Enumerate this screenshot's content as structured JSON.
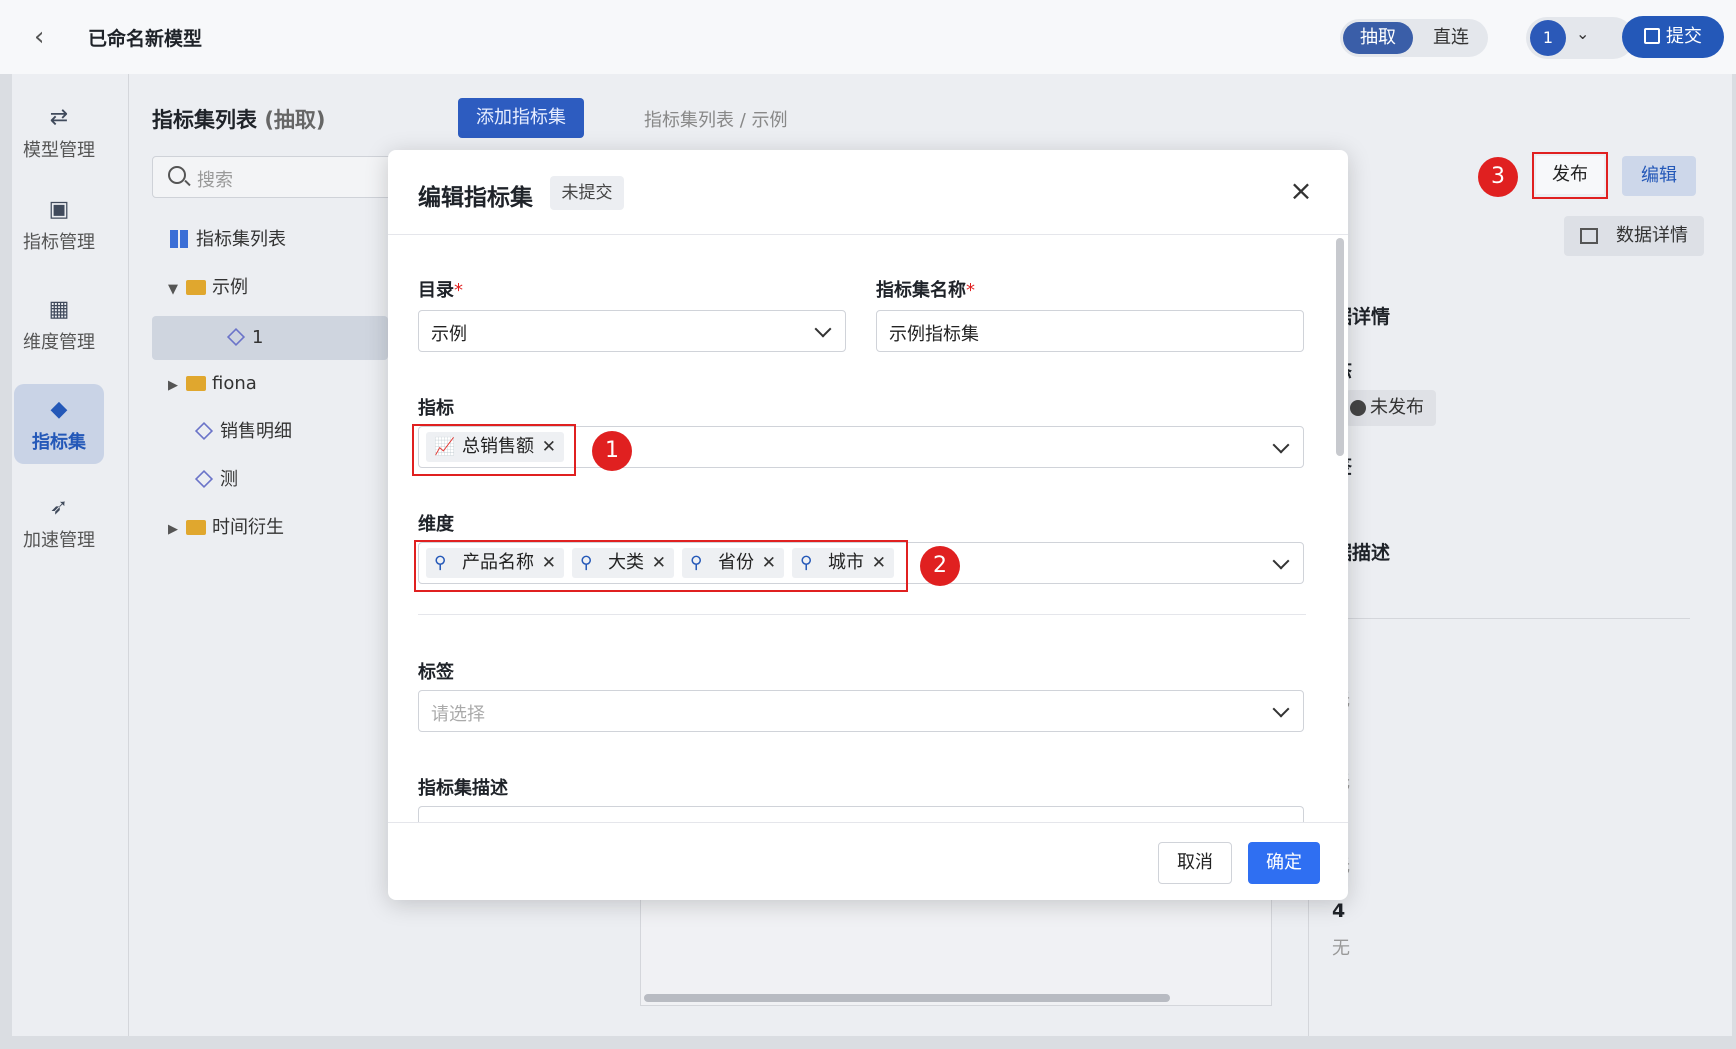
{
  "header": {
    "title": "已命名新模型",
    "mode_extract": "抽取",
    "mode_direct": "直连",
    "user_badge": "1",
    "submit_label": "提交"
  },
  "nav": [
    {
      "label": "模型管理",
      "icon": "model-icon"
    },
    {
      "label": "指标管理",
      "icon": "chart-icon"
    },
    {
      "label": "维度管理",
      "icon": "dimension-icon"
    },
    {
      "label": "指标集",
      "icon": "cube-icon"
    },
    {
      "label": "加速管理",
      "icon": "rocket-icon"
    }
  ],
  "list": {
    "title": "指标集列表",
    "title_suffix": "(抽取)",
    "add_label": "添加指标集",
    "search_placeholder": "搜索",
    "tree": [
      {
        "label": "指标集列表",
        "icon": "grid-icon"
      },
      {
        "label": "示例",
        "icon": "folder-icon"
      },
      {
        "label": "1",
        "icon": "cube-icon"
      },
      {
        "label": "fiona",
        "icon": "folder-icon"
      },
      {
        "label": "销售明细",
        "icon": "cube-icon"
      },
      {
        "label": "测",
        "icon": "cube-icon"
      },
      {
        "label": "时间衍生",
        "icon": "folder-icon"
      }
    ]
  },
  "main": {
    "breadcrumb": "指标集列表 / 示例",
    "publish_label": "发布",
    "edit_label": "编辑",
    "detail_label": "数据详情",
    "step3": "3",
    "right": {
      "section_title": "数据详情",
      "status_title": "状态",
      "status_value": "未发布",
      "tag_title": "标签",
      "tag_value": "无",
      "desc_title": "数据描述",
      "desc_value": "无",
      "v1": "无",
      "v2": "无",
      "v3": "无",
      "count": "4",
      "v4": "无"
    }
  },
  "modal": {
    "title": "编辑指标集",
    "status_tag": "未提交",
    "catalog_label": "目录",
    "catalog_value": "示例",
    "name_label": "指标集名称",
    "name_value": "示例指标集",
    "metric_label": "指标",
    "metrics": [
      "总销售额"
    ],
    "dimension_label": "维度",
    "dimensions": [
      "产品名称",
      "大类",
      "省份",
      "城市"
    ],
    "tags_label": "标签",
    "tags_placeholder": "请选择",
    "desc_label": "指标集描述",
    "cancel_label": "取消",
    "ok_label": "确定",
    "step1": "1",
    "step2": "2"
  }
}
